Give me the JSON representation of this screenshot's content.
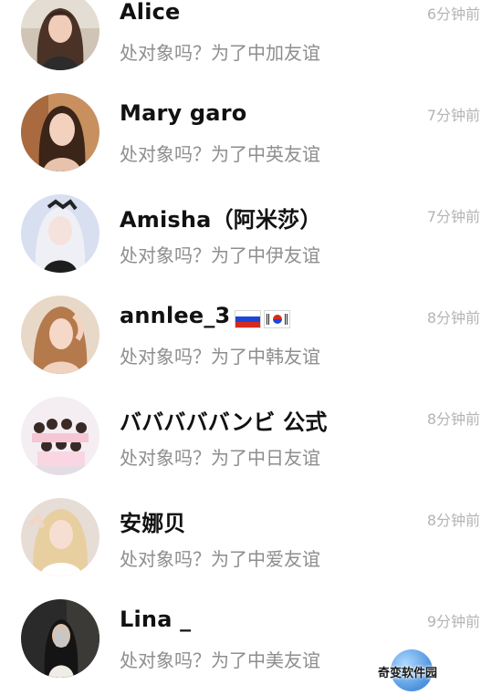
{
  "conversations": [
    {
      "name": "Alice",
      "message": "处对象吗？为了中加友谊",
      "time": "6分钟前",
      "avatar": "avatar-alice"
    },
    {
      "name": "Mary garo",
      "message": "处对象吗？为了中英友谊",
      "time": "7分钟前",
      "avatar": "avatar-mary-garo"
    },
    {
      "name": "Amisha（阿米莎）",
      "message": "处对象吗？为了中伊友谊",
      "time": "7分钟前",
      "avatar": "avatar-amisha"
    },
    {
      "name": "annlee_3",
      "message": "处对象吗？为了中韩友谊",
      "time": "8分钟前",
      "avatar": "avatar-annlee",
      "flags": [
        "russia-flag-icon",
        "south-korea-flag-icon"
      ]
    },
    {
      "name": "バババババンビ 公式",
      "message": "处对象吗？为了中日友谊",
      "time": "8分钟前",
      "avatar": "avatar-group"
    },
    {
      "name": "安娜贝",
      "message": "处对象吗？为了中爱友谊",
      "time": "8分钟前",
      "avatar": "avatar-annabel"
    },
    {
      "name": "Lina _",
      "message": "处对象吗？为了中美友谊",
      "time": "9分钟前",
      "avatar": "avatar-lina"
    }
  ],
  "watermark": {
    "text": "奇变软件园"
  },
  "colors": {
    "name": "#111111",
    "message": "#8e8e8e",
    "time": "#b4b4b4",
    "background": "#ffffff"
  }
}
